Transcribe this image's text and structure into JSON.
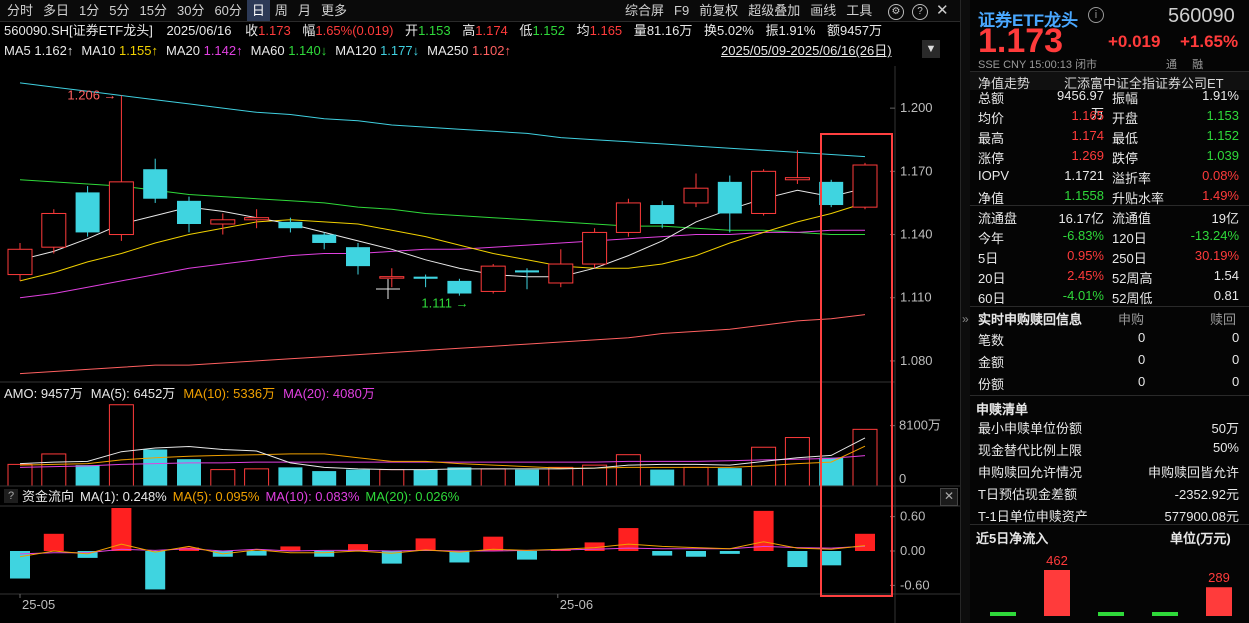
{
  "toolbar": {
    "periods": [
      "分时",
      "多日",
      "1分",
      "5分",
      "15分",
      "30分",
      "60分",
      "日",
      "周",
      "月",
      "更多"
    ],
    "active_period": "日",
    "actions": [
      "综合屏",
      "F9",
      "前复权",
      "超级叠加",
      "画线",
      "工具"
    ]
  },
  "quote_line": {
    "code_name": "560090.SH[证券ETF龙头]",
    "date": "2025/06/16",
    "close_label": "收",
    "close": "1.173",
    "change_label": "幅",
    "change": "1.65%(0.019)",
    "open_label": "开",
    "open": "1.153",
    "high_label": "高",
    "high": "1.174",
    "low_label": "低",
    "low": "1.152",
    "avg_label": "均",
    "avg": "1.165",
    "volume_label": "量",
    "volume": "81.16万",
    "turnover_label": "换",
    "turnover": "5.02%",
    "amplitude_label": "振",
    "amplitude": "1.91%",
    "amount_label": "额",
    "amount": "9457万"
  },
  "ma_line": {
    "items": [
      {
        "label": "MA5",
        "value": "1.162↑",
        "color": "#e8e8e8"
      },
      {
        "label": "MA10",
        "value": "1.155↑",
        "color": "#f0d000"
      },
      {
        "label": "MA20",
        "value": "1.142↑",
        "color": "#e040e0"
      },
      {
        "label": "MA60",
        "value": "1.140↓",
        "color": "#2fd93a"
      },
      {
        "label": "MA120",
        "value": "1.177↓",
        "color": "#40d0e0"
      },
      {
        "label": "MA250",
        "value": "1.102↑",
        "color": "#ff6060"
      }
    ],
    "date_range": "2025/05/09-2025/06/16(26日)"
  },
  "colors": {
    "up": "#ff3b3b",
    "down": "#3fd4e0",
    "ma5": "#e8e8e8",
    "ma10": "#f0d000",
    "ma20": "#e040e0",
    "ma60": "#2fd93a",
    "ma120": "#40d0e0",
    "ma250": "#ff6060",
    "highlight": "#ff4040"
  },
  "chart_data": [
    {
      "type": "candlestick",
      "title": "",
      "y_ticks": [
        "1.200",
        "1.170",
        "1.140",
        "1.110",
        "1.080"
      ],
      "ylim": [
        1.07,
        1.22
      ],
      "annotations": [
        {
          "text": "1.206",
          "kind": "high"
        },
        {
          "text": "1.111",
          "kind": "low"
        }
      ],
      "candles": [
        {
          "o": 1.121,
          "c": 1.133,
          "h": 1.136,
          "l": 1.118
        },
        {
          "o": 1.134,
          "c": 1.15,
          "h": 1.152,
          "l": 1.131
        },
        {
          "o": 1.16,
          "c": 1.141,
          "h": 1.163,
          "l": 1.139
        },
        {
          "o": 1.14,
          "c": 1.165,
          "h": 1.206,
          "l": 1.137
        },
        {
          "o": 1.171,
          "c": 1.157,
          "h": 1.176,
          "l": 1.155
        },
        {
          "o": 1.156,
          "c": 1.145,
          "h": 1.158,
          "l": 1.141
        },
        {
          "o": 1.145,
          "c": 1.147,
          "h": 1.15,
          "l": 1.14
        },
        {
          "o": 1.147,
          "c": 1.148,
          "h": 1.152,
          "l": 1.143
        },
        {
          "o": 1.146,
          "c": 1.143,
          "h": 1.148,
          "l": 1.141
        },
        {
          "o": 1.14,
          "c": 1.136,
          "h": 1.141,
          "l": 1.133
        },
        {
          "o": 1.134,
          "c": 1.125,
          "h": 1.136,
          "l": 1.121
        },
        {
          "o": 1.12,
          "c": 1.12,
          "h": 1.124,
          "l": 1.115
        },
        {
          "o": 1.12,
          "c": 1.119,
          "h": 1.121,
          "l": 1.115
        },
        {
          "o": 1.118,
          "c": 1.112,
          "h": 1.119,
          "l": 1.111
        },
        {
          "o": 1.113,
          "c": 1.125,
          "h": 1.126,
          "l": 1.112
        },
        {
          "o": 1.123,
          "c": 1.122,
          "h": 1.124,
          "l": 1.114
        },
        {
          "o": 1.117,
          "c": 1.126,
          "h": 1.133,
          "l": 1.115
        },
        {
          "o": 1.126,
          "c": 1.141,
          "h": 1.143,
          "l": 1.124
        },
        {
          "o": 1.141,
          "c": 1.155,
          "h": 1.157,
          "l": 1.139
        },
        {
          "o": 1.154,
          "c": 1.145,
          "h": 1.156,
          "l": 1.143
        },
        {
          "o": 1.155,
          "c": 1.162,
          "h": 1.169,
          "l": 1.153
        },
        {
          "o": 1.165,
          "c": 1.15,
          "h": 1.168,
          "l": 1.141
        },
        {
          "o": 1.15,
          "c": 1.17,
          "h": 1.171,
          "l": 1.149
        },
        {
          "o": 1.166,
          "c": 1.167,
          "h": 1.18,
          "l": 1.164
        },
        {
          "o": 1.165,
          "c": 1.154,
          "h": 1.166,
          "l": 1.153
        },
        {
          "o": 1.153,
          "c": 1.173,
          "h": 1.174,
          "l": 1.152
        }
      ],
      "ma5": [
        1.128,
        1.132,
        1.138,
        1.145,
        1.149,
        1.153,
        1.151,
        1.148,
        1.145,
        1.141,
        1.137,
        1.133,
        1.128,
        1.124,
        1.121,
        1.12,
        1.12,
        1.124,
        1.13,
        1.137,
        1.146,
        1.152,
        1.157,
        1.161,
        1.158,
        1.162
      ],
      "ma10": [
        1.118,
        1.122,
        1.127,
        1.131,
        1.136,
        1.14,
        1.143,
        1.146,
        1.147,
        1.146,
        1.145,
        1.142,
        1.139,
        1.135,
        1.131,
        1.128,
        1.125,
        1.124,
        1.124,
        1.126,
        1.13,
        1.136,
        1.141,
        1.146,
        1.15,
        1.155
      ],
      "ma20": [
        1.11,
        1.112,
        1.115,
        1.118,
        1.121,
        1.124,
        1.126,
        1.128,
        1.13,
        1.131,
        1.131,
        1.132,
        1.133,
        1.133,
        1.134,
        1.135,
        1.136,
        1.137,
        1.138,
        1.139,
        1.14,
        1.14,
        1.141,
        1.141,
        1.142,
        1.142
      ],
      "ma60": [
        1.166,
        1.165,
        1.164,
        1.163,
        1.161,
        1.159,
        1.158,
        1.157,
        1.156,
        1.155,
        1.153,
        1.152,
        1.15,
        1.149,
        1.148,
        1.147,
        1.146,
        1.145,
        1.144,
        1.144,
        1.143,
        1.142,
        1.142,
        1.141,
        1.14,
        1.14
      ],
      "ma120": [
        1.212,
        1.21,
        1.208,
        1.206,
        1.204,
        1.202,
        1.2,
        1.198,
        1.197,
        1.195,
        1.194,
        1.192,
        1.191,
        1.19,
        1.189,
        1.188,
        1.186,
        1.185,
        1.184,
        1.183,
        1.182,
        1.181,
        1.18,
        1.179,
        1.178,
        1.177
      ],
      "ma250": [
        1.074,
        1.075,
        1.076,
        1.077,
        1.078,
        1.078,
        1.079,
        1.08,
        1.081,
        1.082,
        1.083,
        1.084,
        1.085,
        1.086,
        1.087,
        1.088,
        1.089,
        1.09,
        1.091,
        1.093,
        1.094,
        1.095,
        1.097,
        1.099,
        1.1,
        1.102
      ]
    },
    {
      "type": "bar",
      "title": "AMO",
      "header": [
        {
          "label": "AMO:",
          "value": "9457万",
          "color": "#e8e8e8"
        },
        {
          "label": "MA(5):",
          "value": "6452万",
          "color": "#e8e8e8"
        },
        {
          "label": "MA(10):",
          "value": "5336万",
          "color": "#f0a000"
        },
        {
          "label": "MA(20):",
          "value": "4080万",
          "color": "#e040e0"
        }
      ],
      "y_ticks": [
        "8100万",
        "0"
      ],
      "ylim": [
        0,
        11000
      ],
      "values": [
        2900,
        4300,
        2800,
        10900,
        4900,
        3600,
        2200,
        2300,
        2500,
        2000,
        2200,
        2200,
        2200,
        2500,
        2300,
        2200,
        2500,
        2800,
        4200,
        2200,
        2500,
        2400,
        5200,
        6500,
        3800,
        7600
      ],
      "ma5": [
        3000,
        3200,
        3300,
        4600,
        5100,
        5300,
        4900,
        4700,
        3100,
        2500,
        2300,
        2200,
        2200,
        2300,
        2300,
        2300,
        2300,
        2400,
        2800,
        2900,
        2900,
        2800,
        3300,
        3800,
        4100,
        6452
      ],
      "ma10": [
        2800,
        2900,
        3000,
        3500,
        3800,
        4000,
        4100,
        4200,
        4300,
        4300,
        3800,
        3300,
        3300,
        3000,
        2800,
        2600,
        2400,
        2400,
        2500,
        2500,
        2500,
        2500,
        2700,
        3000,
        3200,
        5336
      ],
      "ma20": [
        2500,
        2600,
        2700,
        2900,
        3000,
        3100,
        3100,
        3200,
        3200,
        3200,
        3200,
        3200,
        3200,
        3200,
        3200,
        3200,
        3200,
        3200,
        3300,
        3300,
        3300,
        3400,
        3500,
        3600,
        3700,
        4080
      ]
    },
    {
      "type": "bar",
      "title": "资金流向",
      "header": [
        {
          "label": "资金流向",
          "value": "",
          "color": "#e8e8e8"
        },
        {
          "label": "MA(1):",
          "value": "0.248%",
          "color": "#e8e8e8"
        },
        {
          "label": "MA(5):",
          "value": "0.095%",
          "color": "#f0a000"
        },
        {
          "label": "MA(10):",
          "value": "0.083%",
          "color": "#e040e0"
        },
        {
          "label": "MA(20):",
          "value": "0.026%",
          "color": "#2fd93a"
        }
      ],
      "y_ticks": [
        "0.60",
        "0.00",
        "-0.60"
      ],
      "ylim": [
        -0.75,
        0.75
      ],
      "x_ticks": [
        "25-05",
        "25-06"
      ],
      "values": [
        -0.48,
        0.3,
        -0.12,
        0.75,
        -0.67,
        0.06,
        -0.1,
        -0.08,
        0.08,
        -0.1,
        0.12,
        -0.22,
        0.22,
        -0.2,
        0.25,
        -0.15,
        0.03,
        0.15,
        0.4,
        -0.08,
        -0.1,
        -0.05,
        0.7,
        -0.28,
        -0.25,
        0.3
      ],
      "ma5": [
        -0.1,
        0.0,
        -0.05,
        0.12,
        -0.02,
        0.08,
        -0.05,
        0.02,
        -0.03,
        -0.03,
        0.0,
        -0.04,
        0.02,
        -0.02,
        0.03,
        0.01,
        0.03,
        0.06,
        0.12,
        0.08,
        0.06,
        0.04,
        0.16,
        0.05,
        0.03,
        0.095
      ],
      "ma10": [
        -0.05,
        -0.03,
        -0.03,
        0.03,
        0.01,
        0.04,
        0.0,
        0.03,
        0.0,
        0.01,
        0.01,
        0.0,
        0.01,
        0.0,
        0.0,
        0.01,
        0.02,
        0.03,
        0.05,
        0.04,
        0.04,
        0.04,
        0.08,
        0.06,
        0.05,
        0.083
      ]
    },
    {
      "type": "bar",
      "title": "近5日净流入",
      "unit": "单位(万元)",
      "values": [
        12,
        462,
        10,
        9,
        289
      ],
      "labels": [
        "",
        "462",
        "",
        "",
        "289"
      ],
      "colors": [
        "#2fd93a",
        "#ff3b3b",
        "#2fd93a",
        "#2fd93a",
        "#ff3b3b"
      ]
    }
  ],
  "right": {
    "name": "证券ETF龙头",
    "code": "560090",
    "price": "1.173",
    "change": "+0.019",
    "change_pct": "+1.65%",
    "exchange": "SSE",
    "currency": "CNY",
    "time": "15:00:13",
    "status": "闭市",
    "flags": [
      "通",
      "融"
    ],
    "tab_label": "净值走势",
    "fund_name": "汇添富中证全指证券公司ET",
    "stats": [
      [
        {
          "k": "总额",
          "v": "9456.97万",
          "vc": "white"
        },
        {
          "k": "振幅",
          "v": "1.91%",
          "vc": "white"
        }
      ],
      [
        {
          "k": "均价",
          "v": "1.165",
          "vc": "red"
        },
        {
          "k": "开盘",
          "v": "1.153",
          "vc": "green"
        }
      ],
      [
        {
          "k": "最高",
          "v": "1.174",
          "vc": "red"
        },
        {
          "k": "最低",
          "v": "1.152",
          "vc": "green"
        }
      ],
      [
        {
          "k": "涨停",
          "v": "1.269",
          "vc": "red"
        },
        {
          "k": "跌停",
          "v": "1.039",
          "vc": "green"
        }
      ],
      [
        {
          "k": "IOPV",
          "v": "1.1721",
          "vc": "white"
        },
        {
          "k": "溢折率",
          "v": "0.08%",
          "vc": "red"
        }
      ],
      [
        {
          "k": "净值",
          "v": "1.1558",
          "vc": "green"
        },
        {
          "k": "升贴水率",
          "v": "1.49%",
          "vc": "red"
        }
      ],
      [
        {
          "k": "流通盘",
          "v": "16.17亿",
          "vc": "white"
        },
        {
          "k": "流通值",
          "v": "19亿",
          "vc": "white"
        }
      ],
      [
        {
          "k": "今年",
          "v": "-6.83%",
          "vc": "green"
        },
        {
          "k": "120日",
          "v": "-13.24%",
          "vc": "green"
        }
      ],
      [
        {
          "k": "5日",
          "v": "0.95%",
          "vc": "red"
        },
        {
          "k": "250日",
          "v": "30.19%",
          "vc": "red"
        }
      ],
      [
        {
          "k": "20日",
          "v": "2.45%",
          "vc": "red"
        },
        {
          "k": "52周高",
          "v": "1.54",
          "vc": "white"
        }
      ],
      [
        {
          "k": "60日",
          "v": "-4.01%",
          "vc": "green"
        },
        {
          "k": "52周低",
          "v": "0.81",
          "vc": "white"
        }
      ]
    ],
    "realtime": {
      "title": "实时申购赎回信息",
      "col1": "申购",
      "col2": "赎回",
      "rows": [
        {
          "k": "笔数",
          "a": "0",
          "b": "0"
        },
        {
          "k": "金额",
          "a": "0",
          "b": "0"
        },
        {
          "k": "份额",
          "a": "0",
          "b": "0"
        }
      ]
    },
    "list": {
      "title": "申赎清单",
      "rows": [
        {
          "k": "最小申赎单位份额",
          "v": "50万"
        },
        {
          "k": "现金替代比例上限",
          "v": "50%"
        },
        {
          "k": "申购赎回允许情况",
          "v": "申购赎回皆允许"
        },
        {
          "k": "T日预估现金差额",
          "v": "-2352.92元"
        },
        {
          "k": "T-1日单位申赎资产",
          "v": "577900.08元"
        }
      ]
    }
  }
}
